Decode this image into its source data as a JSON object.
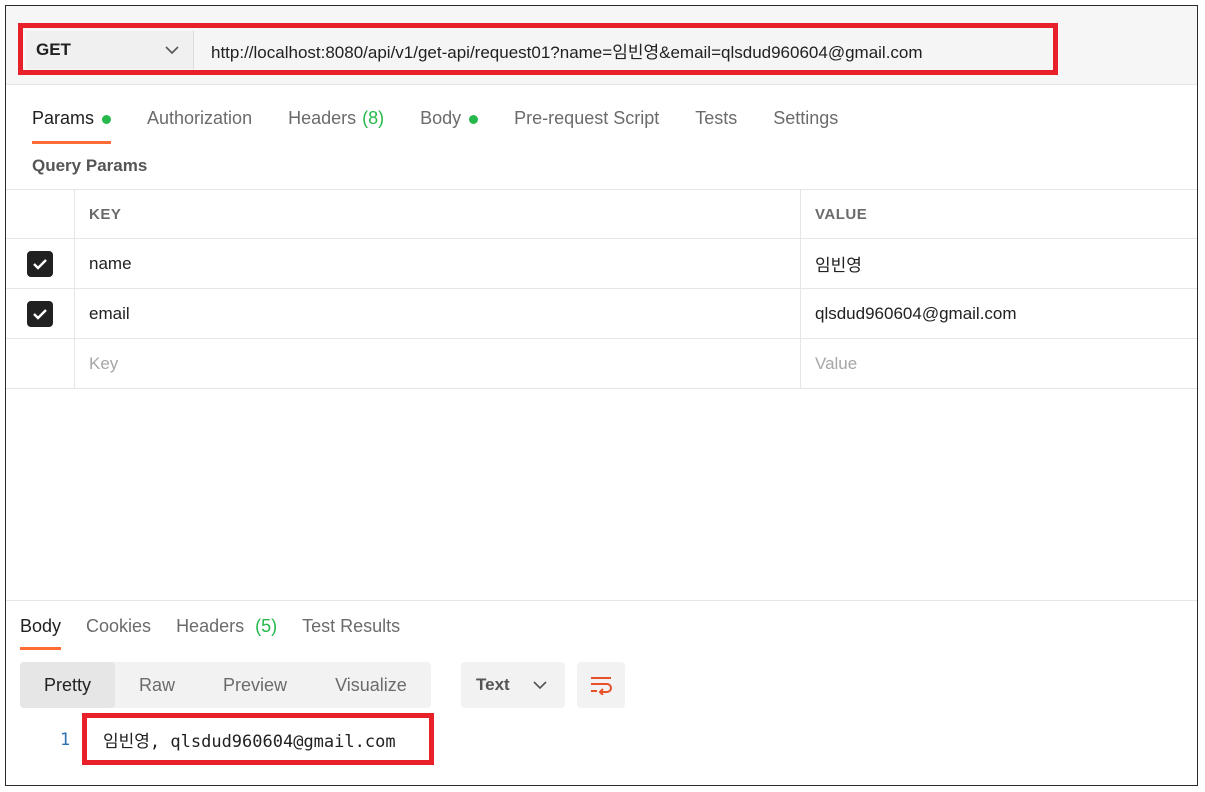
{
  "request": {
    "method": "GET",
    "url": "http://localhost:8080/api/v1/get-api/request01?name=임빈영&email=qlsdud960604@gmail.com"
  },
  "request_tabs": [
    {
      "label": "Params",
      "dot": true,
      "active": true
    },
    {
      "label": "Authorization"
    },
    {
      "label": "Headers",
      "count": "(8)"
    },
    {
      "label": "Body",
      "dot": true
    },
    {
      "label": "Pre-request Script"
    },
    {
      "label": "Tests"
    },
    {
      "label": "Settings"
    }
  ],
  "query_params": {
    "title": "Query Params",
    "headers": {
      "key": "KEY",
      "value": "VALUE"
    },
    "rows": [
      {
        "key": "name",
        "value": "임빈영",
        "checked": true
      },
      {
        "key": "email",
        "value": "qlsdud960604@gmail.com",
        "checked": true
      }
    ],
    "placeholder": {
      "key": "Key",
      "value": "Value"
    }
  },
  "response": {
    "tabs": [
      {
        "label": "Body",
        "active": true
      },
      {
        "label": "Cookies"
      },
      {
        "label": "Headers",
        "count": "(5)"
      },
      {
        "label": "Test Results"
      }
    ],
    "views": [
      "Pretty",
      "Raw",
      "Preview",
      "Visualize"
    ],
    "active_view": "Pretty",
    "format": "Text",
    "lines": [
      {
        "number": "1",
        "text": "임빈영, qlsdud960604@gmail.com"
      }
    ]
  },
  "colors": {
    "accent": "#ff6c37",
    "highlight": "#e8202a",
    "status_green": "#26b84a"
  }
}
